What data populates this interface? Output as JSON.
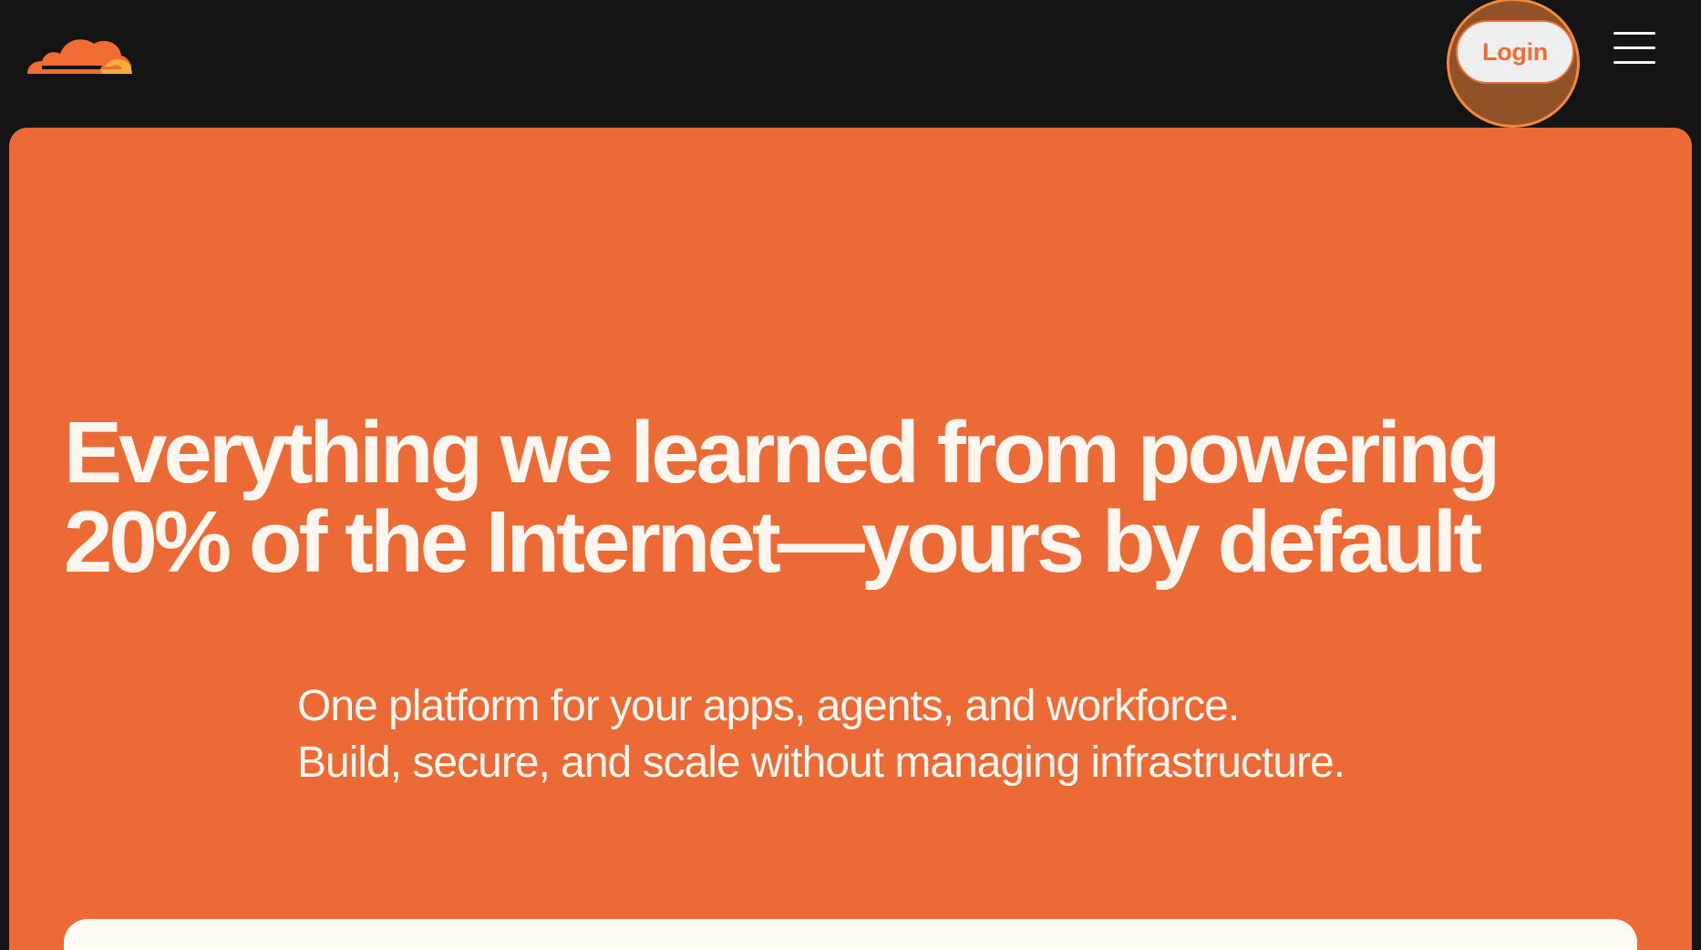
{
  "header": {
    "logo_icon": "cloud-logo-icon",
    "login_label": "Login",
    "menu_icon": "hamburger-menu-icon"
  },
  "hero": {
    "title_line_1": "Everything we learned from powering",
    "title_line_2": "20% of the Internet—yours by default",
    "subtitle_line_1": "One platform for your apps, agents, and workforce.",
    "subtitle_line_2": "Build, secure, and scale without managing infrastructure."
  },
  "colors": {
    "page_background": "#141414",
    "hero_background": "#eb6a35",
    "text_light": "#fff7ef",
    "card_background": "#fffbf4",
    "logo_orange": "#f06c32",
    "logo_yellow": "#f2ad3d",
    "login_ring": "#f38a3b"
  }
}
